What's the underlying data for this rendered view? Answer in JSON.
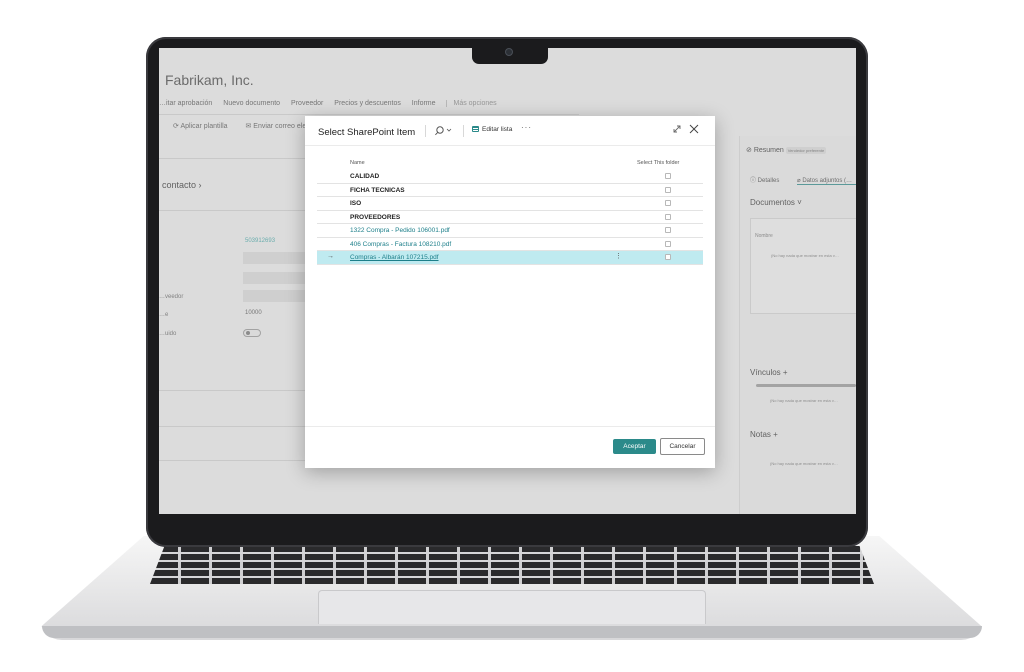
{
  "app": {
    "company": "Fabrikam, Inc.",
    "menu": [
      "…itar aprobación",
      "Nuevo documento",
      "Proveedor",
      "Precios y descuentos",
      "Informe"
    ],
    "menu_more": "Más opciones",
    "toolbar": [
      "Aplicar plantilla",
      "Enviar correo electr…"
    ],
    "section_contact": "contacto",
    "fields": {
      "value1": "503912693",
      "value2": "10000",
      "label_proveedor": "…veedor",
      "label_e": "…e",
      "label_uido": "…uido"
    }
  },
  "factbox": {
    "title": "Resumen",
    "badge": "Vendedor preferente",
    "tabs": [
      "Detalles",
      "Datos adjuntos (…"
    ],
    "documentos": "Documentos",
    "nombre": "Nombre",
    "empty1": "(No hay nada que mostrar en esta v…",
    "vinculos": "Vínculos",
    "empty2": "(No hay nada que mostrar en esta v…",
    "notas": "Notas",
    "empty3": "(No hay nada que mostrar en esta v…"
  },
  "dialog": {
    "title": "Select SharePoint Item",
    "edit_list": "Editar lista",
    "more": "···",
    "columns": {
      "name": "Name",
      "select": "Select This folder"
    },
    "rows": [
      {
        "name": "CALIDAD",
        "kind": "folder"
      },
      {
        "name": "FICHA TECNICAS",
        "kind": "folder"
      },
      {
        "name": "ISO",
        "kind": "folder"
      },
      {
        "name": "PROVEEDORES",
        "kind": "folder"
      },
      {
        "name": "1322 Compra - Pedido 106001.pdf",
        "kind": "file"
      },
      {
        "name": "406 Compras - Factura 108210.pdf",
        "kind": "file"
      },
      {
        "name": "Compras - Albarán 107215.pdf",
        "kind": "file",
        "selected": true
      }
    ],
    "row_arrow": "→",
    "row_menu": "⋮",
    "ok": "Aceptar",
    "cancel": "Cancelar"
  },
  "colors": {
    "accent": "#2b8a8a",
    "selected_row": "#bfeaf0"
  }
}
